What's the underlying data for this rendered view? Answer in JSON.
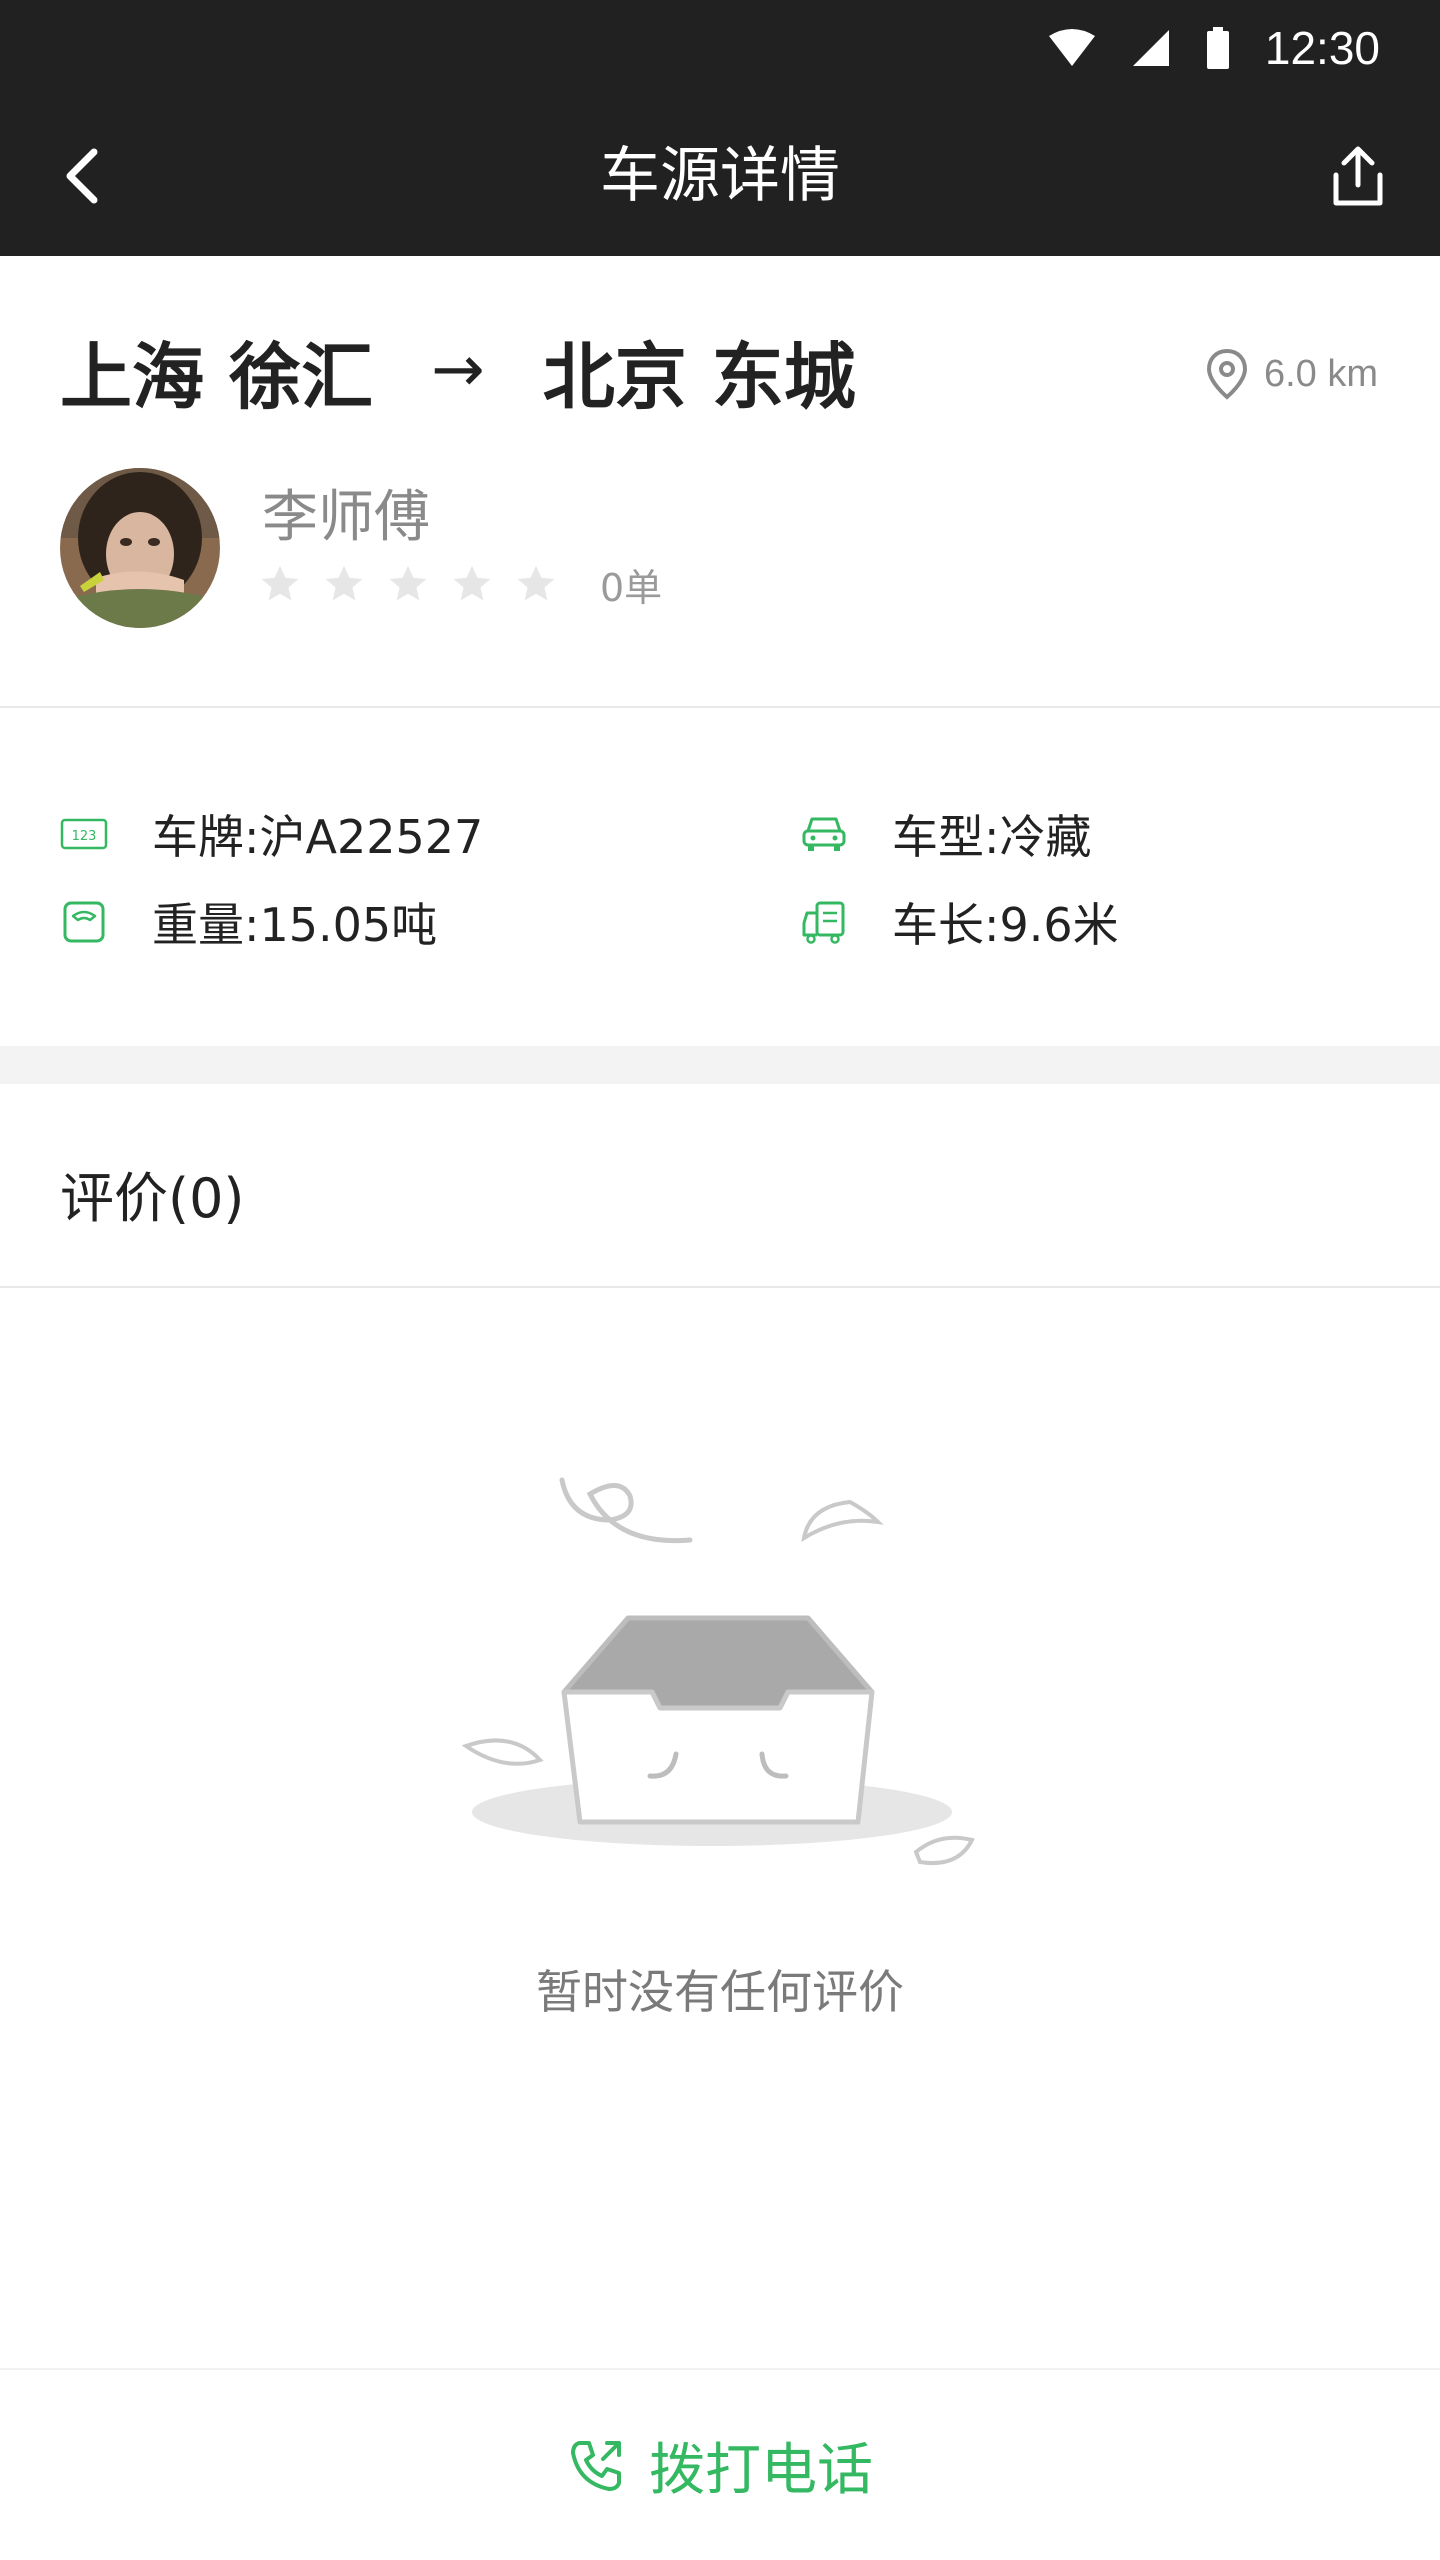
{
  "status_bar": {
    "time": "12:30"
  },
  "app_bar": {
    "title": "车源详情"
  },
  "route": {
    "origin": "上海 徐汇",
    "arrow": "→",
    "destination": "北京 东城",
    "distance": "6.0 km"
  },
  "driver": {
    "name": "李师傅",
    "rating_stars": 0,
    "rating_max": 5,
    "orders": "0单"
  },
  "vehicle": {
    "plate": "车牌:沪A22527",
    "type": "车型:冷藏",
    "weight": "重量:15.05吨",
    "length": "车长:9.6米"
  },
  "reviews": {
    "title": "评价(0)",
    "empty_text": "暂时没有任何评价"
  },
  "call": {
    "label": "拨打电话"
  },
  "colors": {
    "bar_bg": "#212121",
    "accent_green": "#35b862",
    "muted": "#8a8a8a",
    "divider": "#e8e8e8"
  },
  "icons": [
    "back-arrow",
    "share",
    "location-pin",
    "star",
    "plate-123",
    "car",
    "scale",
    "truck",
    "phone"
  ]
}
